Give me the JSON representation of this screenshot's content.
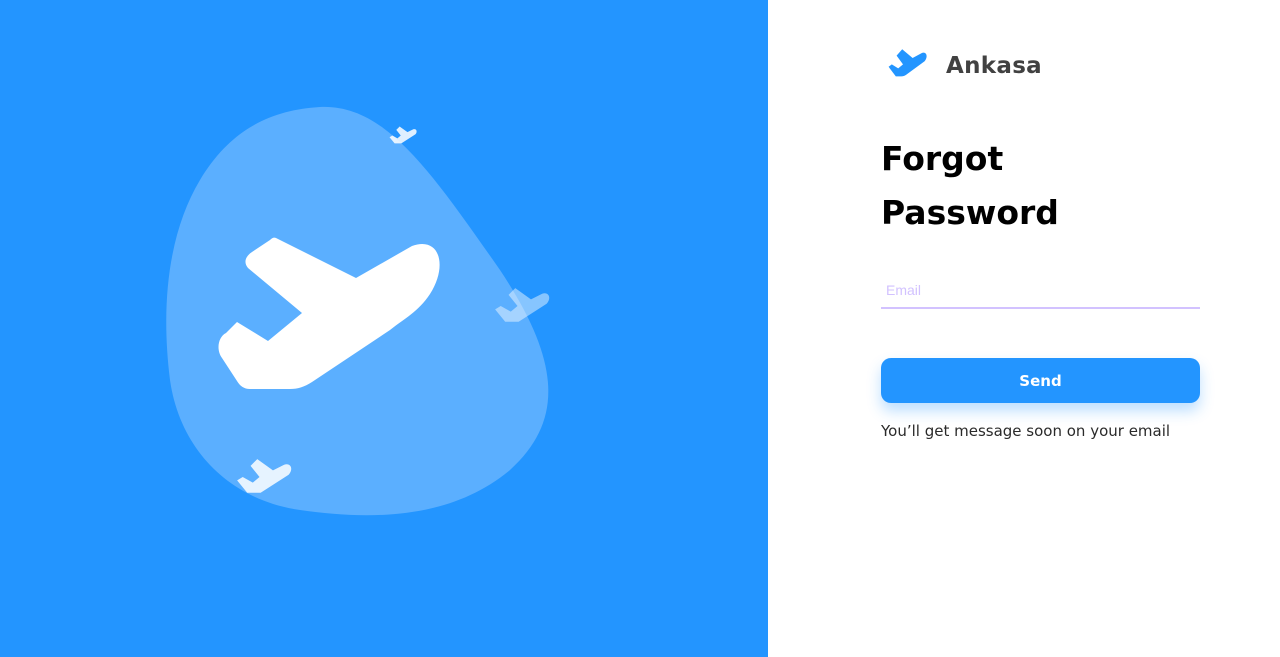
{
  "colors": {
    "primary": "#2395FF",
    "hero_background": "#2395FF",
    "blob": "#5BAFFF",
    "input_underline": "#D2C2FF",
    "title": "#000000",
    "brand_text": "#414141"
  },
  "hero": {
    "illustration": "airplane-illustration",
    "icons": [
      "airplane-icon",
      "airplane-icon",
      "airplane-icon",
      "airplane-icon"
    ]
  },
  "brand": {
    "logo_icon": "airplane-icon",
    "name": "Ankasa"
  },
  "form": {
    "title": "Forgot Password",
    "email": {
      "value": "",
      "placeholder": "Email"
    },
    "send_label": "Send",
    "helper_text": "You’ll get message soon on your email"
  }
}
